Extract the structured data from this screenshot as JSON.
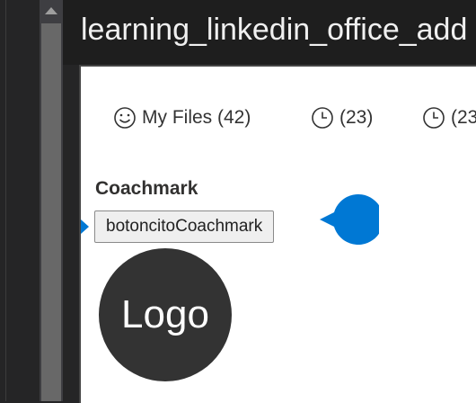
{
  "window": {
    "title": "learning_linkedin_office_add"
  },
  "pivot": {
    "items": [
      {
        "label": "My Files (42)",
        "icon": "smiley-icon"
      },
      {
        "label": "(23)",
        "icon": "clock-icon"
      },
      {
        "label": "(23",
        "icon": "clock-icon"
      }
    ]
  },
  "coachmark_section": {
    "label": "Coachmark",
    "button_label": "botoncitoCoachmark"
  },
  "logo": {
    "text": "Logo"
  },
  "colors": {
    "accent": "#0078d4",
    "logo_bg": "#333333",
    "title_bg": "#1e1e1e"
  }
}
